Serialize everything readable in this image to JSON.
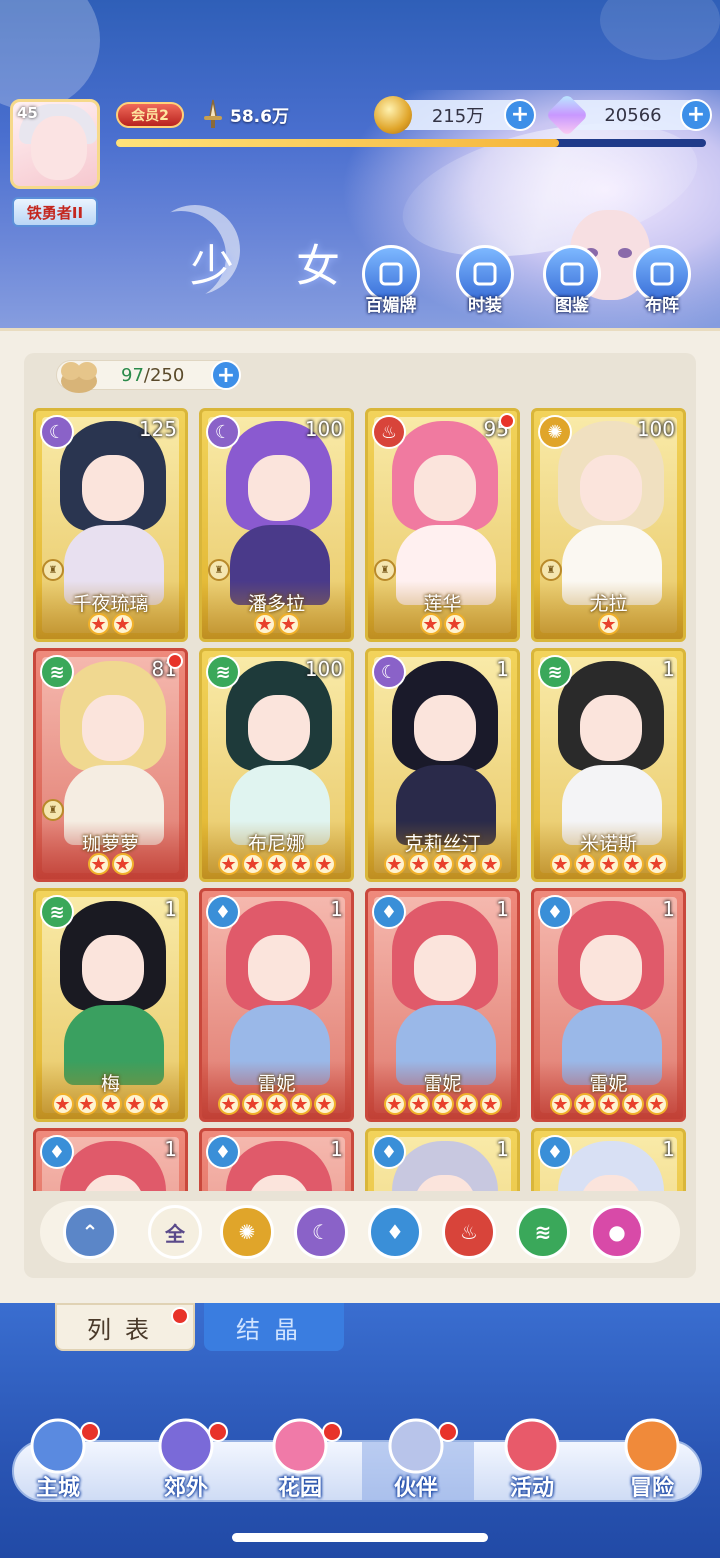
{
  "player": {
    "level": "45",
    "title": "铁勇者II",
    "vip": "会员2",
    "power": "58.6万",
    "exp_fraction": 0.75
  },
  "resources": {
    "gold": "215万",
    "gems": "20566"
  },
  "header": {
    "title": "少 女"
  },
  "menu": [
    {
      "label": "百媚牌",
      "icon": "card-deck-icon"
    },
    {
      "label": "时装",
      "icon": "costume-icon"
    },
    {
      "label": "图鉴",
      "icon": "book-icon"
    },
    {
      "label": "布阵",
      "icon": "grid-icon"
    }
  ],
  "inventory": {
    "current": "97",
    "max": "/250"
  },
  "characters": [
    {
      "name": "千夜琉璃",
      "level": "125",
      "element": "moon",
      "stars": 2,
      "frame": "gold",
      "badge": false,
      "hair": "#2a3550",
      "body": "#e8e0f0"
    },
    {
      "name": "潘多拉",
      "level": "100",
      "element": "moon",
      "stars": 2,
      "frame": "gold",
      "badge": false,
      "hair": "#8a5ad0",
      "body": "#4a3a8a"
    },
    {
      "name": "莲华",
      "level": "95",
      "element": "fire",
      "stars": 2,
      "frame": "gold",
      "badge": true,
      "hair": "#f07aa0",
      "body": "#fff0f0"
    },
    {
      "name": "尤拉",
      "level": "100",
      "element": "light",
      "stars": 1,
      "frame": "gold",
      "badge": false,
      "hair": "#f0e0c0",
      "body": "#fbf8f2"
    },
    {
      "name": "珈萝萝",
      "level": "81",
      "element": "wind",
      "stars": 2,
      "frame": "red",
      "badge": true,
      "hair": "#f0d890",
      "body": "#f5ede2"
    },
    {
      "name": "布尼娜",
      "level": "100",
      "element": "wind",
      "stars": 5,
      "frame": "gold",
      "badge": false,
      "hair": "#1e3a3a",
      "body": "#e0f4f0"
    },
    {
      "name": "克莉丝汀",
      "level": "1",
      "element": "moon",
      "stars": 5,
      "frame": "gold",
      "badge": false,
      "hair": "#1a1a2a",
      "body": "#2a2a4a"
    },
    {
      "name": "米诺斯",
      "level": "1",
      "element": "wind",
      "stars": 5,
      "frame": "gold",
      "badge": false,
      "hair": "#2a2a2a",
      "body": "#f4f4f6"
    },
    {
      "name": "梅",
      "level": "1",
      "element": "wind",
      "stars": 5,
      "frame": "gold",
      "badge": false,
      "hair": "#1a1a22",
      "body": "#3aa060"
    },
    {
      "name": "雷妮",
      "level": "1",
      "element": "water",
      "stars": 5,
      "frame": "red",
      "badge": false,
      "hair": "#e05a6a",
      "body": "#9ab8e8"
    },
    {
      "name": "雷妮",
      "level": "1",
      "element": "water",
      "stars": 5,
      "frame": "red",
      "badge": false,
      "hair": "#e05a6a",
      "body": "#9ab8e8"
    },
    {
      "name": "雷妮",
      "level": "1",
      "element": "water",
      "stars": 5,
      "frame": "red",
      "badge": false,
      "hair": "#e05a6a",
      "body": "#9ab8e8"
    },
    {
      "name": "",
      "level": "1",
      "element": "water",
      "stars": 0,
      "frame": "red",
      "badge": false,
      "hair": "#e05a6a",
      "body": "#9ab8e8"
    },
    {
      "name": "",
      "level": "1",
      "element": "water",
      "stars": 0,
      "frame": "red",
      "badge": false,
      "hair": "#e05a6a",
      "body": "#9ab8e8"
    },
    {
      "name": "",
      "level": "1",
      "element": "water",
      "stars": 0,
      "frame": "gold",
      "badge": false,
      "hair": "#c8c8e0",
      "body": "#e8e8f4"
    },
    {
      "name": "",
      "level": "1",
      "element": "water",
      "stars": 0,
      "frame": "gold",
      "badge": false,
      "hair": "#d8e0f4",
      "body": "#eef0fa"
    }
  ],
  "filters": [
    {
      "id": "expand",
      "icon": "chevron-up-icon",
      "label": "",
      "color": "#5b86c8"
    },
    {
      "id": "all",
      "icon": "",
      "label": "全",
      "color": "#f5efe0"
    },
    {
      "id": "light",
      "icon": "gear-sun-icon",
      "label": "",
      "color": "#e0a52a"
    },
    {
      "id": "moon",
      "icon": "crescent-icon",
      "label": "",
      "color": "#8a62c8"
    },
    {
      "id": "water",
      "icon": "water-drop-icon",
      "label": "",
      "color": "#3a8fd8"
    },
    {
      "id": "fire",
      "icon": "flame-icon",
      "label": "",
      "color": "#d8443a"
    },
    {
      "id": "wind",
      "icon": "wind-icon",
      "label": "",
      "color": "#3aa85a"
    },
    {
      "id": "star",
      "icon": "orb-icon",
      "label": "",
      "color": "#d84aa8"
    }
  ],
  "tabs": {
    "list": "列表",
    "crystal": "结晶"
  },
  "nav": [
    {
      "label": "主城",
      "icon": "castle-icon",
      "badge": true
    },
    {
      "label": "郊外",
      "icon": "portal-icon",
      "badge": true
    },
    {
      "label": "花园",
      "icon": "heart-icon",
      "badge": true
    },
    {
      "label": "伙伴",
      "icon": "partner-avatar-icon",
      "badge": true
    },
    {
      "label": "活动",
      "icon": "gift-icon",
      "badge": false
    },
    {
      "label": "冒险",
      "icon": "compass-icon",
      "badge": false
    }
  ],
  "colors": {
    "moon": "#8a62c8",
    "fire": "#d8443a",
    "light": "#e0a52a",
    "wind": "#3aa85a",
    "water": "#3a8fd8"
  }
}
